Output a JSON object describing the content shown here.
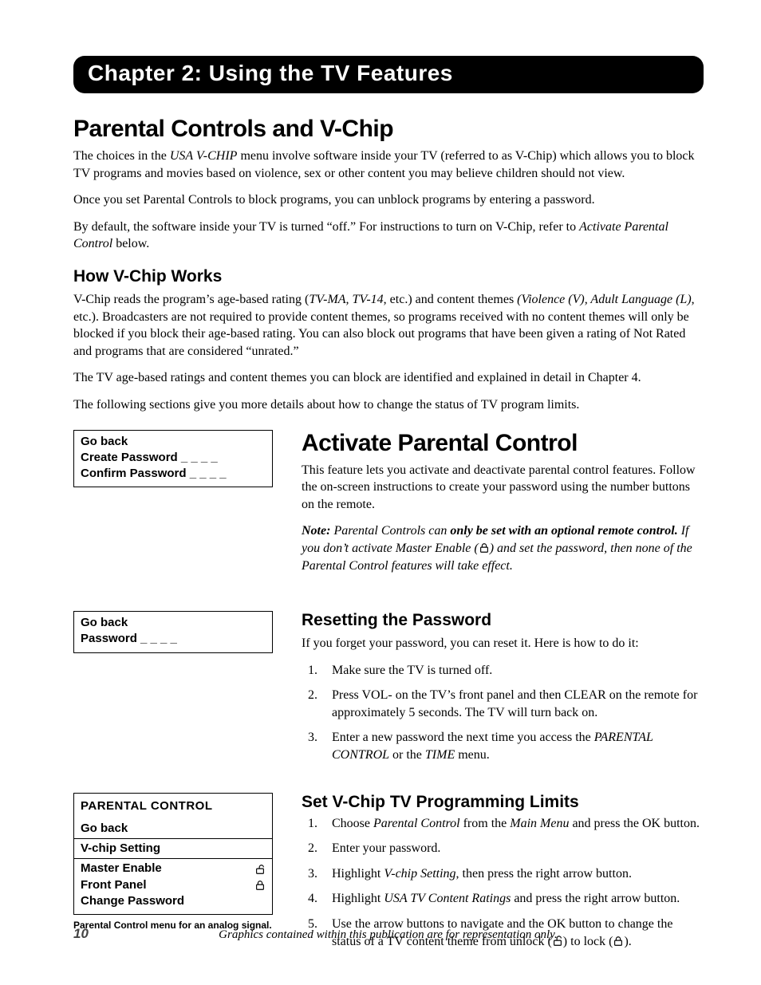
{
  "chapter_bar": "Chapter 2: Using the TV Features",
  "h1_parental": "Parental Controls and V-Chip",
  "p_intro_1a": "The choices in the ",
  "p_intro_1b": "USA V-CHIP",
  "p_intro_1c": " menu involve software inside your TV (referred to as V-Chip) which allows you to block TV programs and movies based on violence, sex or other content you may believe children should not view.",
  "p_intro_2": "Once you set Parental Controls to block programs, you can unblock programs by entering a password.",
  "p_intro_3a": "By default, the software inside your TV is turned “off.” For instructions to turn on V-Chip, refer to ",
  "p_intro_3b": "Activate Parental Control",
  "p_intro_3c": " below.",
  "h2_how": "How V-Chip Works",
  "p_how_1a": "V-Chip reads the program’s age-based rating (",
  "p_how_1b": "TV-MA, TV-14",
  "p_how_1c": ", etc.) and content themes ",
  "p_how_1d": "(Violence (V), Adult Language (L)",
  "p_how_1e": ", etc.). Broadcasters are not required to provide content themes, so programs received with no content themes will only be blocked if you block their age-based rating. You can also block out programs that have been given a rating of Not Rated and programs that are considered “unrated.”",
  "p_how_2": "The TV age-based ratings and content themes you can block are identified and explained in detail in Chapter 4.",
  "p_how_3": "The following sections give you more details about how to change the status of TV program limits.",
  "menu1": {
    "line1": "Go back",
    "line2": "Create Password _ _ _ _",
    "line3": "Confirm Password _ _ _ _"
  },
  "h1_activate": "Activate Parental Control",
  "p_activate_1": "This feature lets you activate and deactivate parental control features. Follow the on-screen instructions to create your password using the number buttons on the remote.",
  "note_label": "Note:",
  "note_a": "  Parental Controls can ",
  "note_bold": "only be set with an optional remote control.",
  "note_b": "  If you don’t activate Master Enable (",
  "note_c": ") and set the password, then none of the Parental Control features will take effect.",
  "menu2": {
    "line1": "Go back",
    "line2": "Password _ _ _ _"
  },
  "h2_reset": "Resetting the Password",
  "p_reset_intro": "If you forget your password, you can reset it. Here is how to do it:",
  "reset_steps": {
    "s1": "Make sure the TV is turned off.",
    "s2": "Press VOL- on the TV’s front panel and then CLEAR on the remote for approximately 5 seconds. The TV will turn back on.",
    "s3a": "Enter a new password the next time you access the ",
    "s3b": "PARENTAL CONTROL",
    "s3c": " or the ",
    "s3d": "TIME",
    "s3e": " menu."
  },
  "menu3": {
    "title": "PARENTAL CONTROL",
    "line1": "Go back",
    "line2": "V-chip Setting",
    "line3": "Master Enable",
    "line4": "Front Panel",
    "line5": "Change Password"
  },
  "menu3_caption": "Parental Control menu for an analog signal.",
  "h2_setv": "Set V-Chip TV Programming Limits",
  "setv_steps": {
    "s1a": "Choose ",
    "s1b": "Parental Control",
    "s1c": " from the ",
    "s1d": "Main Menu",
    "s1e": " and press the OK button.",
    "s2": "Enter your password.",
    "s3a": "Highlight ",
    "s3b": "V-chip Setting",
    "s3c": ", then press the right arrow button.",
    "s4a": "Highlight ",
    "s4b": "USA TV Content Ratings",
    "s4c": " and press the right arrow button.",
    "s5a": "Use the arrow buttons to navigate and the OK button to change the status of a TV content theme from unlock (",
    "s5b": ") to lock (",
    "s5c": ")."
  },
  "page_number": "10",
  "footer_text": "Graphics contained within this publication are for representation only."
}
